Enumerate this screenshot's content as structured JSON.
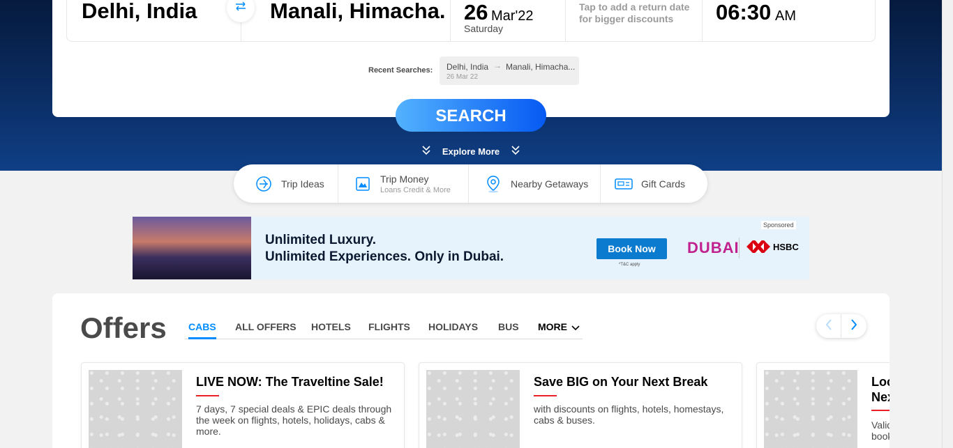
{
  "search": {
    "from_city": "Delhi, India",
    "to_city": "Manali, Himacha.",
    "date": {
      "day": "26",
      "month": "Mar'22",
      "weekday": "Saturday"
    },
    "return_prompt": "Tap to add a return date for bigger discounts",
    "time": {
      "value": "06:30",
      "ampm": "AM"
    },
    "recent_label": "Recent Searches:",
    "recent": {
      "from": "Delhi, India",
      "to": "Manali, Himacha...",
      "date": "26 Mar 22"
    },
    "button_label": "SEARCH",
    "explore_label": "Explore More"
  },
  "quick_links": [
    {
      "label": "Trip Ideas",
      "sub": "",
      "icon": "trip-ideas-icon"
    },
    {
      "label": "Trip Money",
      "sub": "Loans Credit & More",
      "icon": "trip-money-icon"
    },
    {
      "label": "Nearby Getaways",
      "sub": "",
      "icon": "location-pin-icon"
    },
    {
      "label": "Gift Cards",
      "sub": "",
      "icon": "gift-card-icon"
    }
  ],
  "ad": {
    "line1": "Unlimited Luxury.",
    "line2": "Unlimited Experiences. Only in Dubai.",
    "button": "Book Now",
    "tc": "*T&C apply",
    "brand1": "DUBAI",
    "brand2": "HSBC",
    "sponsored": "Sponsored"
  },
  "offers": {
    "title": "Offers",
    "tabs": [
      "CABS",
      "ALL OFFERS",
      "HOTELS",
      "FLIGHTS",
      "HOLIDAYS",
      "BUS",
      "MORE"
    ],
    "active_tab": "CABS",
    "cards": [
      {
        "title": "LIVE NOW: The Traveltine Sale!",
        "desc": "7 days, 7 special deals & EPIC deals through the week on flights, hotels, holidays, cabs & more."
      },
      {
        "title": "Save BIG on Your Next Break",
        "desc": "with discounts on flights, hotels, homestays, cabs & buses."
      },
      {
        "title": "Lock Next",
        "desc": "Valid book"
      }
    ]
  },
  "colors": {
    "accent": "#008cff",
    "hero": "#0b2d63",
    "red_rule": "#eb2026"
  }
}
